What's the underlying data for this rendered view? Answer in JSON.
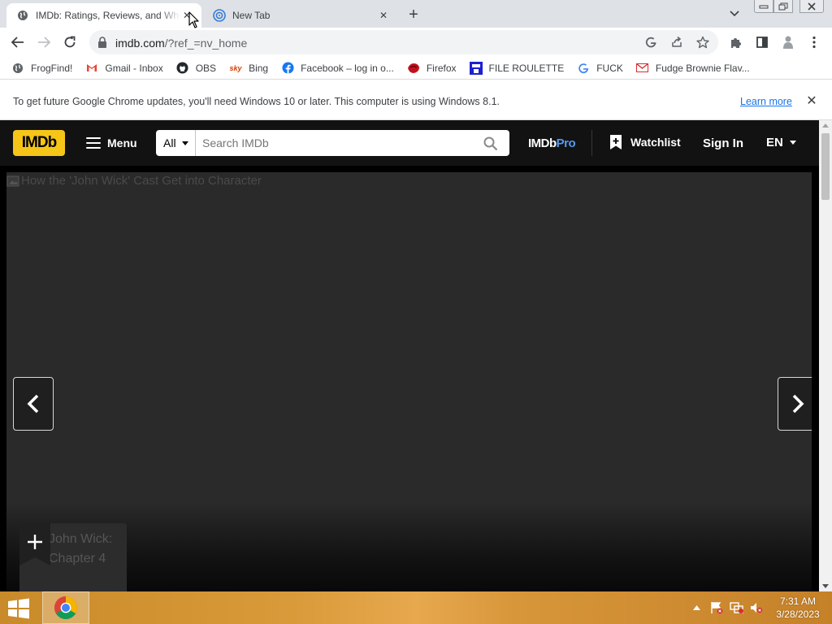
{
  "browser": {
    "tabs": [
      {
        "title": "IMDb: Ratings, Reviews, and Where to Watch the Best Movies & TV Shows",
        "favicon": "globe-icon",
        "active": true
      },
      {
        "title": "New Tab",
        "favicon": "new-tab-icon",
        "active": false
      }
    ],
    "url": {
      "host": "imdb.com",
      "path": "/?ref_=nv_home"
    },
    "bookmarks": [
      {
        "label": "FrogFind!",
        "icon": "frog-icon"
      },
      {
        "label": "Gmail - Inbox",
        "icon": "gmail-icon"
      },
      {
        "label": "OBS",
        "icon": "github-icon"
      },
      {
        "label": "Bing",
        "icon": "bing-icon"
      },
      {
        "label": "Facebook – log in o...",
        "icon": "facebook-icon"
      },
      {
        "label": "Firefox",
        "icon": "firefox-icon"
      },
      {
        "label": "FILE ROULETTE",
        "icon": "roulette-icon"
      },
      {
        "label": "FUCK",
        "icon": "google-icon"
      },
      {
        "label": "Fudge Brownie Flav...",
        "icon": "mail-icon"
      }
    ],
    "infobar": {
      "message": "To get future Google Chrome updates, you'll need Windows 10 or later. This computer is using Windows 8.1.",
      "link": "Learn more"
    }
  },
  "imdb": {
    "logo": "IMDb",
    "menu_label": "Menu",
    "search": {
      "category": "All",
      "placeholder": "Search IMDb"
    },
    "pro": {
      "prefix": "IMDb",
      "suffix": "Pro"
    },
    "watchlist_label": "Watchlist",
    "signin_label": "Sign In",
    "language": "EN",
    "hero": {
      "image_alt": "How the 'John Wick' Cast Get into Character",
      "poster_alt": "John Wick: Chapter 4"
    }
  },
  "taskbar": {
    "time": "7:31 AM",
    "date": "3/28/2023"
  },
  "colors": {
    "imdb_yellow": "#f5c518",
    "imdb_nav_bg": "#121212",
    "pro_blue": "#5799ef",
    "link_blue": "#1a73e8",
    "tabstrip_bg": "#dee1e6"
  }
}
